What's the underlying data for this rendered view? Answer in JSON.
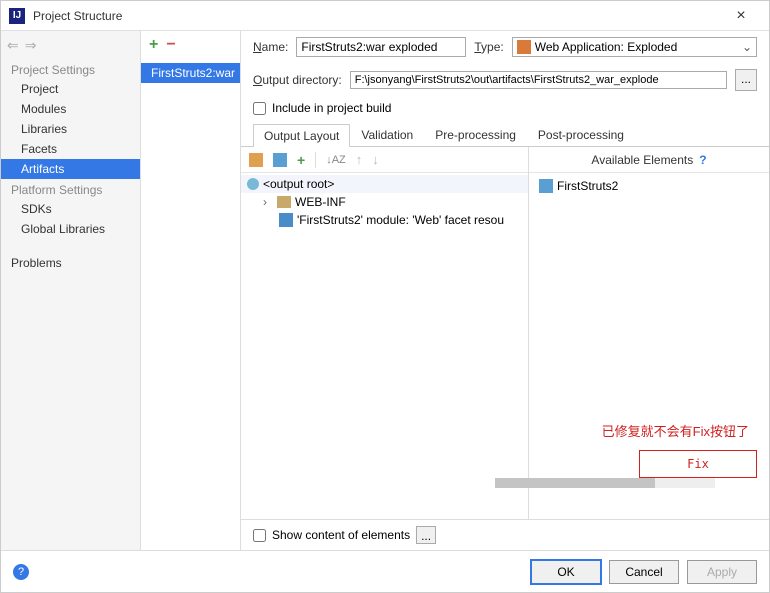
{
  "window": {
    "title": "Project Structure"
  },
  "sidebar": {
    "section1": "Project Settings",
    "items1": [
      "Project",
      "Modules",
      "Libraries",
      "Facets",
      "Artifacts"
    ],
    "selected1": 4,
    "section2": "Platform Settings",
    "items2": [
      "SDKs",
      "Global Libraries"
    ],
    "section3": "",
    "items3": [
      "Problems"
    ]
  },
  "middle": {
    "item": "FirstStruts2:war"
  },
  "form": {
    "name_label": "Name:",
    "name_value": "FirstStruts2:war exploded",
    "type_label": "Type:",
    "type_value": "Web Application: Exploded",
    "outdir_label": "Output directory:",
    "outdir_value": "F:\\jsonyang\\FirstStruts2\\out\\artifacts\\FirstStruts2_war_explode",
    "dots": "...",
    "include_label_pre": "Include in project ",
    "include_label_u": "b",
    "include_label_post": "uild"
  },
  "tabs": [
    "Output Layout",
    "Validation",
    "Pre-processing",
    "Post-processing"
  ],
  "active_tab": 0,
  "tree": {
    "root": "<output root>",
    "webinf": "WEB-INF",
    "facet": "'FirstStruts2' module: 'Web' facet resou"
  },
  "avail": {
    "header": "Available Elements",
    "help": "?",
    "item": "FirstStruts2"
  },
  "annotations": {
    "red_note": "已修复就不会有Fix按钮了",
    "fix": "Fix"
  },
  "bottom": {
    "show_label": "Show content of elements",
    "dots": "..."
  },
  "footer": {
    "ok": "OK",
    "cancel": "Cancel",
    "apply": "Apply"
  }
}
